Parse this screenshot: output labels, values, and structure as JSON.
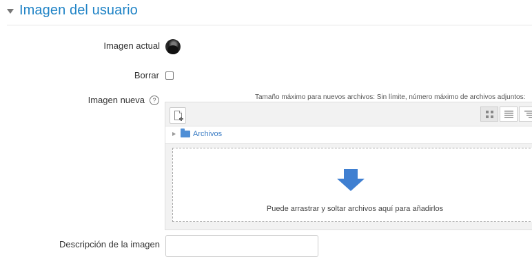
{
  "section": {
    "title": "Imagen del usuario"
  },
  "labels": {
    "current_image": "Imagen actual",
    "delete": "Borrar",
    "new_image": "Imagen nueva",
    "description": "Descripción de la imagen"
  },
  "filepicker": {
    "limits": "Tamaño máximo para nuevos archivos: Sin límite, número máximo de archivos adjuntos:",
    "path_label": "Archivos",
    "drop_text": "Puede arrastrar y soltar archivos aquí para añadirlos",
    "active_view": "icons"
  },
  "description_field": {
    "value": ""
  },
  "colors": {
    "accent": "#1f83c6",
    "drop_arrow": "#3f7fd1",
    "folder": "#4f8fd6"
  }
}
